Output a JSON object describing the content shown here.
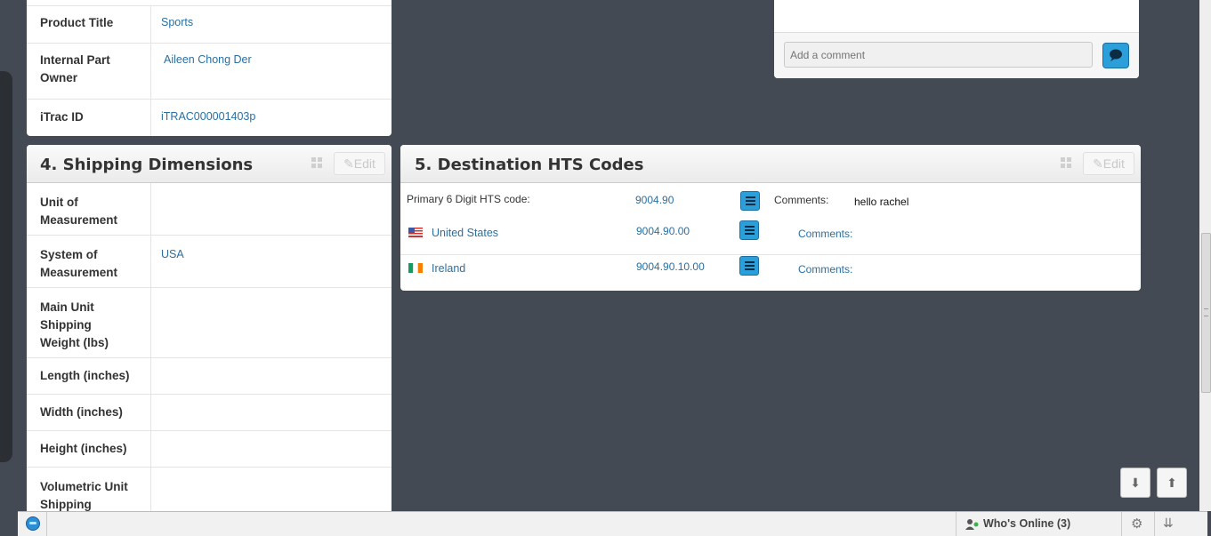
{
  "product_panel": {
    "rows": [
      {
        "key": "Product Title",
        "value": "Sports"
      },
      {
        "key": "Internal Part Owner",
        "value": "Aileen Chong Der"
      },
      {
        "key": "iTrac ID",
        "value": "iTRAC000001403p"
      }
    ]
  },
  "comment_box": {
    "placeholder": "Add a comment",
    "submit_icon": "speech-bubble-icon"
  },
  "shipping_panel": {
    "title": "4. Shipping Dimensions",
    "edit_label": "Edit",
    "rows": [
      {
        "key": "Unit of Measurement",
        "value": ""
      },
      {
        "key": "System of Measurement",
        "value": "USA"
      },
      {
        "key": "Main Unit Shipping Weight (lbs)",
        "value": ""
      },
      {
        "key": "Length (inches)",
        "value": ""
      },
      {
        "key": "Width (inches)",
        "value": ""
      },
      {
        "key": "Height (inches)",
        "value": ""
      },
      {
        "key": "Volumetric Unit Shipping Weight",
        "value": ""
      }
    ]
  },
  "hts_panel": {
    "title": "5. Destination HTS Codes",
    "edit_label": "Edit",
    "primary_label": "Primary 6 Digit HTS code:",
    "primary_code": "9004.90",
    "primary_comments_label": "Comments:",
    "primary_comment": "hello rachel",
    "countries": [
      {
        "name": "United States",
        "code": "9004.90.00",
        "comments_label": "Comments:",
        "flag": "us-flag-icon"
      },
      {
        "name": "Ireland",
        "code": "9004.90.10.00",
        "comments_label": "Comments:",
        "flag": "ireland-flag-icon"
      }
    ]
  },
  "bottom_bar": {
    "whos_online": "Who's Online (3)"
  },
  "colors": {
    "background": "#434a54",
    "link": "#2a6fa0",
    "accent": "#2b9fd9"
  }
}
